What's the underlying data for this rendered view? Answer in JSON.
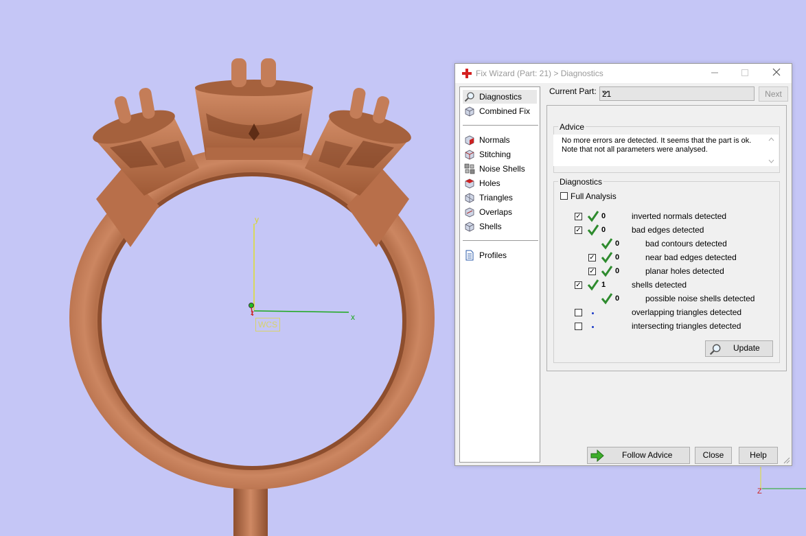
{
  "viewport": {
    "wcs_label": "WCS",
    "axis_y": "y",
    "axis_x": "x",
    "axis_z": "z",
    "corner_axis_z": "Z",
    "background": "#c5c6f6",
    "ring_color": "#c8825e"
  },
  "dialog": {
    "title": "Fix Wizard (Part: 21) > Diagnostics",
    "sidebar": {
      "top_items": [
        {
          "label": "Diagnostics",
          "icon": "magnifier-icon"
        },
        {
          "label": "Combined Fix",
          "icon": "cube-icon"
        }
      ],
      "fix_items": [
        {
          "label": "Normals",
          "icon": "normals-cube-icon"
        },
        {
          "label": "Stitching",
          "icon": "stitching-cube-icon"
        },
        {
          "label": "Noise Shells",
          "icon": "noise-shells-icon"
        },
        {
          "label": "Holes",
          "icon": "holes-cube-icon"
        },
        {
          "label": "Triangles",
          "icon": "triangles-cube-icon"
        },
        {
          "label": "Overlaps",
          "icon": "overlaps-cube-icon"
        },
        {
          "label": "Shells",
          "icon": "shells-cube-icon"
        }
      ],
      "bottom_items": [
        {
          "label": "Profiles",
          "icon": "document-icon"
        }
      ]
    },
    "current_part_label": "Current Part:",
    "current_part_value": "21",
    "next_label": "Next",
    "advice": {
      "title": "Advice",
      "text_line1": "No more errors are detected. It seems that the part is ok.",
      "text_line2": "Note that not all parameters were analysed."
    },
    "diagnostics": {
      "title": "Diagnostics",
      "full_analysis_label": "Full Analysis",
      "full_analysis_checked": false,
      "rows": [
        {
          "label": "inverted normals detected",
          "count": "0"
        },
        {
          "label": "bad edges detected",
          "count": "0"
        },
        {
          "label": "bad contours detected",
          "count": "0"
        },
        {
          "label": "near bad edges detected",
          "count": "0"
        },
        {
          "label": "planar holes detected",
          "count": "0"
        },
        {
          "label": "shells detected",
          "count": "1"
        },
        {
          "label": "possible noise shells detected",
          "count": "0"
        },
        {
          "label": "overlapping triangles detected",
          "count": ""
        },
        {
          "label": "intersecting triangles detected",
          "count": ""
        }
      ],
      "update_label": "Update"
    },
    "buttons": {
      "follow_advice": "Follow Advice",
      "close": "Close",
      "help": "Help"
    },
    "colors": {
      "check_green": "#2e8b2e",
      "dot_blue": "#1a39c6"
    }
  }
}
